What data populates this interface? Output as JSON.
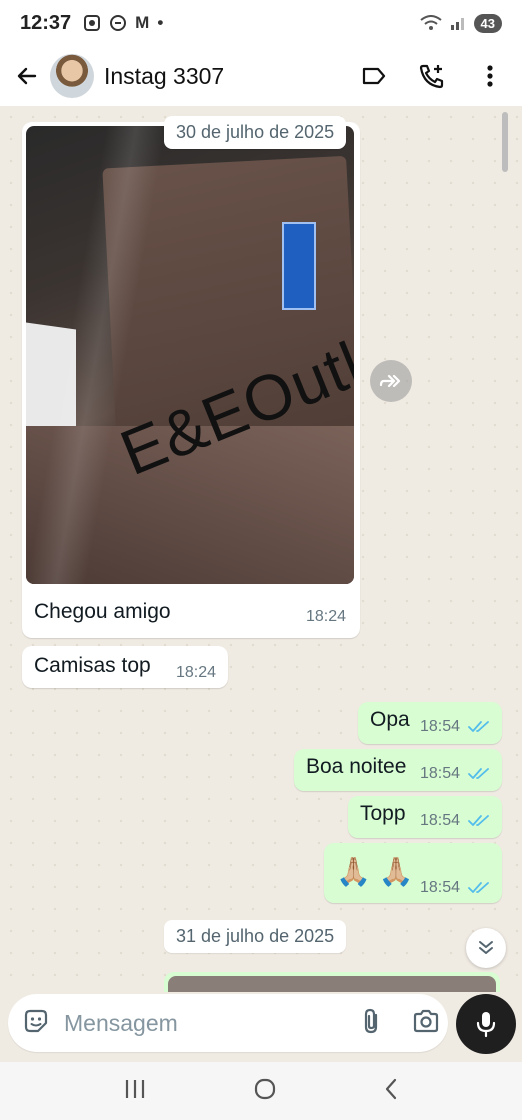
{
  "status_bar": {
    "time": "12:37",
    "notification_letter": "M",
    "battery": "43"
  },
  "header": {
    "contact_name": "Instag 3307"
  },
  "chat": {
    "date_1": "30 de julho de 2025",
    "date_2": "31 de julho de 2025",
    "image_watermark": "E&EOutlet",
    "incoming": [
      {
        "text": "Chegou amigo",
        "time": "18:24"
      },
      {
        "text": "Camisas top",
        "time": "18:24"
      }
    ],
    "outgoing": [
      {
        "text": "Opa",
        "time": "18:54"
      },
      {
        "text": "Boa noitee",
        "time": "18:54"
      },
      {
        "text": "Topp",
        "time": "18:54"
      },
      {
        "text": "🙏🏼 🙏🏼",
        "time": "18:54"
      }
    ]
  },
  "composer": {
    "placeholder": "Mensagem"
  },
  "colors": {
    "outgoing_bubble": "#d9fdd3",
    "incoming_bubble": "#ffffff",
    "chat_background": "#efeae2",
    "read_ticks": "#53bdeb"
  },
  "icons": [
    "back-arrow-icon",
    "avatar",
    "label-icon",
    "add-call-icon",
    "more-vert-icon",
    "forward-icon",
    "double-check-icon",
    "double-chevron-down-icon",
    "sticker-icon",
    "attach-icon",
    "camera-icon",
    "mic-icon",
    "recents-icon",
    "home-icon",
    "nav-back-icon"
  ]
}
